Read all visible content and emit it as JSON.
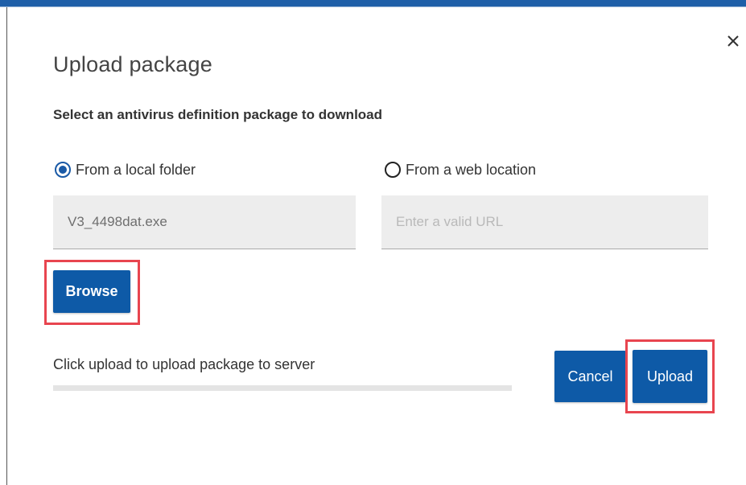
{
  "dialog": {
    "title": "Upload package",
    "subtitle": "Select an antivirus definition package to download",
    "close_label": "X"
  },
  "source_options": [
    {
      "label": "From a local folder",
      "selected": true
    },
    {
      "label": "From a web location",
      "selected": false
    }
  ],
  "local_file": {
    "value": "V3_4498dat.exe"
  },
  "web_url": {
    "value": "",
    "placeholder": "Enter a valid URL"
  },
  "buttons": {
    "browse": "Browse",
    "cancel": "Cancel",
    "upload": "Upload"
  },
  "status": {
    "text": "Click upload to upload package to server",
    "progress_percent": 0
  },
  "colors": {
    "accent": "#0e5aa7",
    "highlight": "#e8454f",
    "top_bar": "#1f5fa8",
    "field_background": "#ededed"
  },
  "icons": {
    "close": "close-icon"
  }
}
